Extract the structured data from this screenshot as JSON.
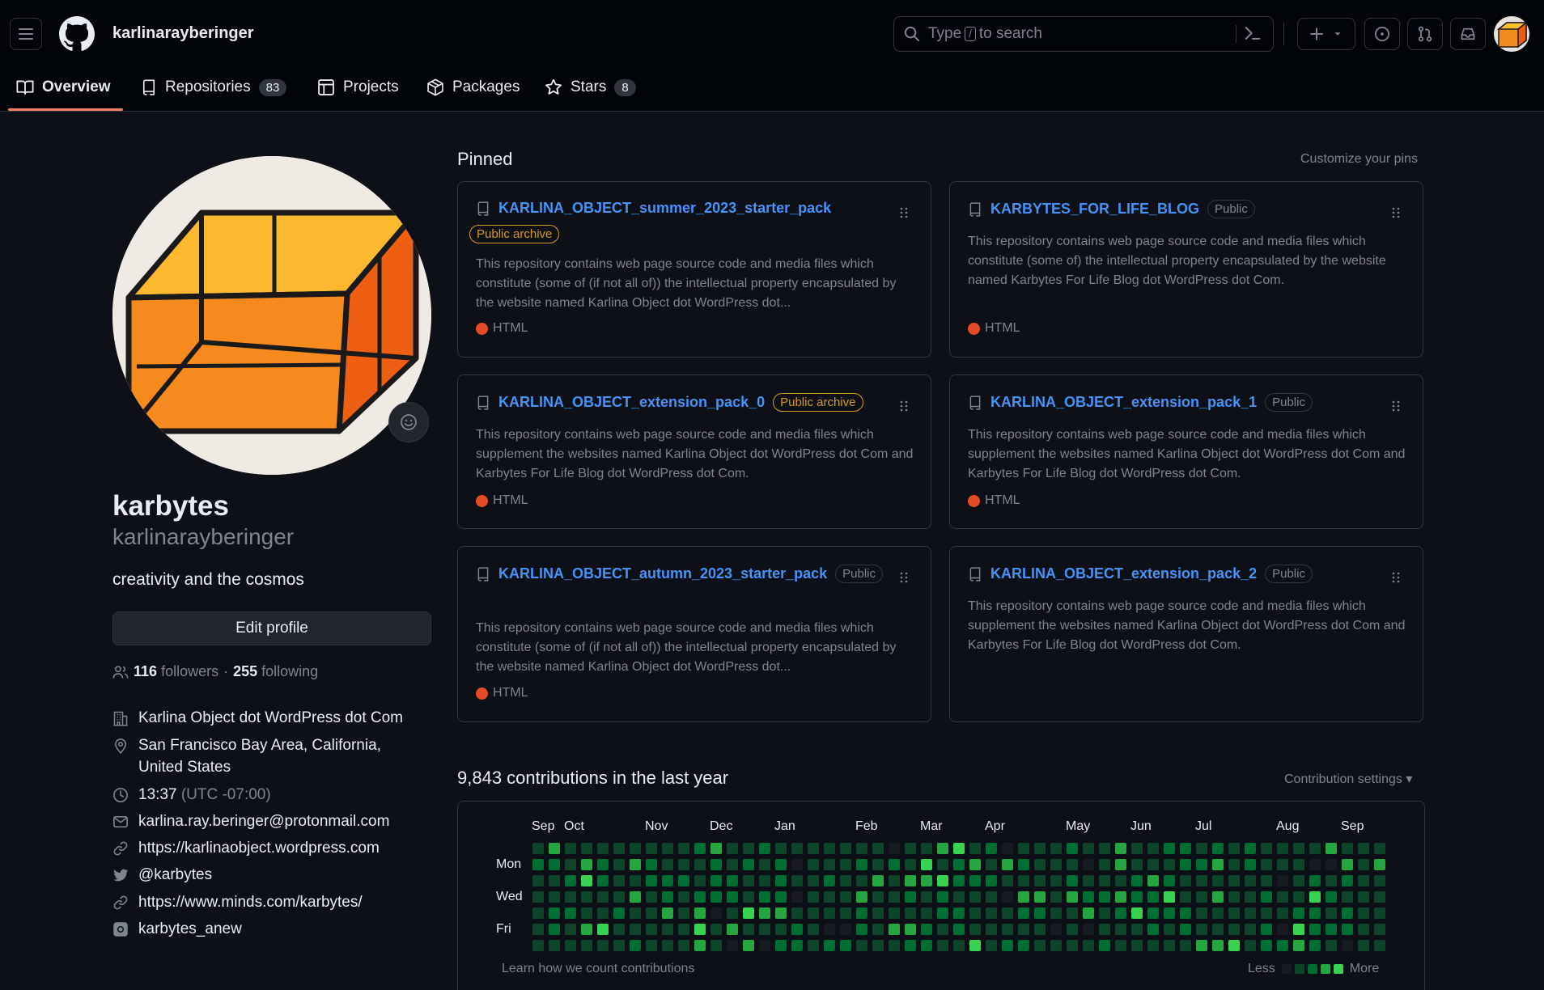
{
  "header": {
    "username": "karlinarayberinger",
    "search_pre": "Type",
    "search_key": "/",
    "search_post": "to search"
  },
  "tabs": [
    {
      "label": "Overview"
    },
    {
      "label": "Repositories",
      "count": "83"
    },
    {
      "label": "Projects"
    },
    {
      "label": "Packages"
    },
    {
      "label": "Stars",
      "count": "8"
    }
  ],
  "profile": {
    "name": "karbytes",
    "login": "karlinarayberinger",
    "bio": "creativity and the cosmos",
    "edit_label": "Edit profile",
    "followers_count": "116",
    "followers_label": "followers",
    "following_count": "255",
    "following_label": "following",
    "company": "Karlina Object dot WordPress dot Com",
    "location": "San Francisco Bay Area, California, United States",
    "time": "13:37",
    "timezone": "(UTC -07:00)",
    "email": "karlina.ray.beringer@protonmail.com",
    "website": "https://karlinaobject.wordpress.com",
    "twitter": "@karbytes",
    "social_link": "https://www.minds.com/karbytes/",
    "instagram": "karbytes_anew"
  },
  "pinned": {
    "title": "Pinned",
    "customize": "Customize your pins",
    "repos": [
      {
        "name": "KARLINA_OBJECT_summer_2023_starter_pack",
        "badge": "Public archive",
        "desc": "This repository contains web page source code and media files which constitute (some of (if not all of)) the intellectual property encapsulated by the website named Karlina Object dot WordPress dot...",
        "lang": "HTML"
      },
      {
        "name": "KARBYTES_FOR_LIFE_BLOG",
        "badge": "Public",
        "desc": "This repository contains web page source code and media files which constitute (some of) the intellectual property encapsulated by the website named Karbytes For Life Blog dot WordPress dot Com.",
        "lang": "HTML"
      },
      {
        "name": "KARLINA_OBJECT_extension_pack_0",
        "badge": "Public archive",
        "desc": "This repository contains web page source code and media files which supplement the websites named Karlina Object dot WordPress dot Com and Karbytes For Life Blog dot WordPress dot Com.",
        "lang": "HTML"
      },
      {
        "name": "KARLINA_OBJECT_extension_pack_1",
        "badge": "Public",
        "desc": "This repository contains web page source code and media files which supplement the websites named Karlina Object dot WordPress dot Com and Karbytes For Life Blog dot WordPress dot Com.",
        "lang": "HTML"
      },
      {
        "name": "KARLINA_OBJECT_autumn_2023_starter_pack",
        "badge": "Public",
        "desc": "This repository contains web page source code and media files which constitute (some of (if not all of)) the intellectual property encapsulated by the website named Karlina Object dot WordPress dot...",
        "lang": "HTML"
      },
      {
        "name": "KARLINA_OBJECT_extension_pack_2",
        "badge": "Public",
        "desc": "This repository contains web page source code and media files which supplement the websites named Karlina Object dot WordPress dot Com and Karbytes For Life Blog dot WordPress dot Com."
      }
    ]
  },
  "contributions": {
    "title": "9,843 contributions in the last year",
    "settings": "Contribution settings",
    "months": [
      "Sep",
      "Oct",
      "Nov",
      "Dec",
      "Jan",
      "Feb",
      "Mar",
      "Apr",
      "May",
      "Jun",
      "Jul",
      "Aug",
      "Sep"
    ],
    "days": [
      "Mon",
      "Wed",
      "Fri"
    ],
    "learn": "Learn how we count contributions",
    "less": "Less",
    "more": "More",
    "colors": [
      "#161b22",
      "#0e4429",
      "#006d32",
      "#26a641",
      "#39d353"
    ],
    "weeks": 53
  }
}
